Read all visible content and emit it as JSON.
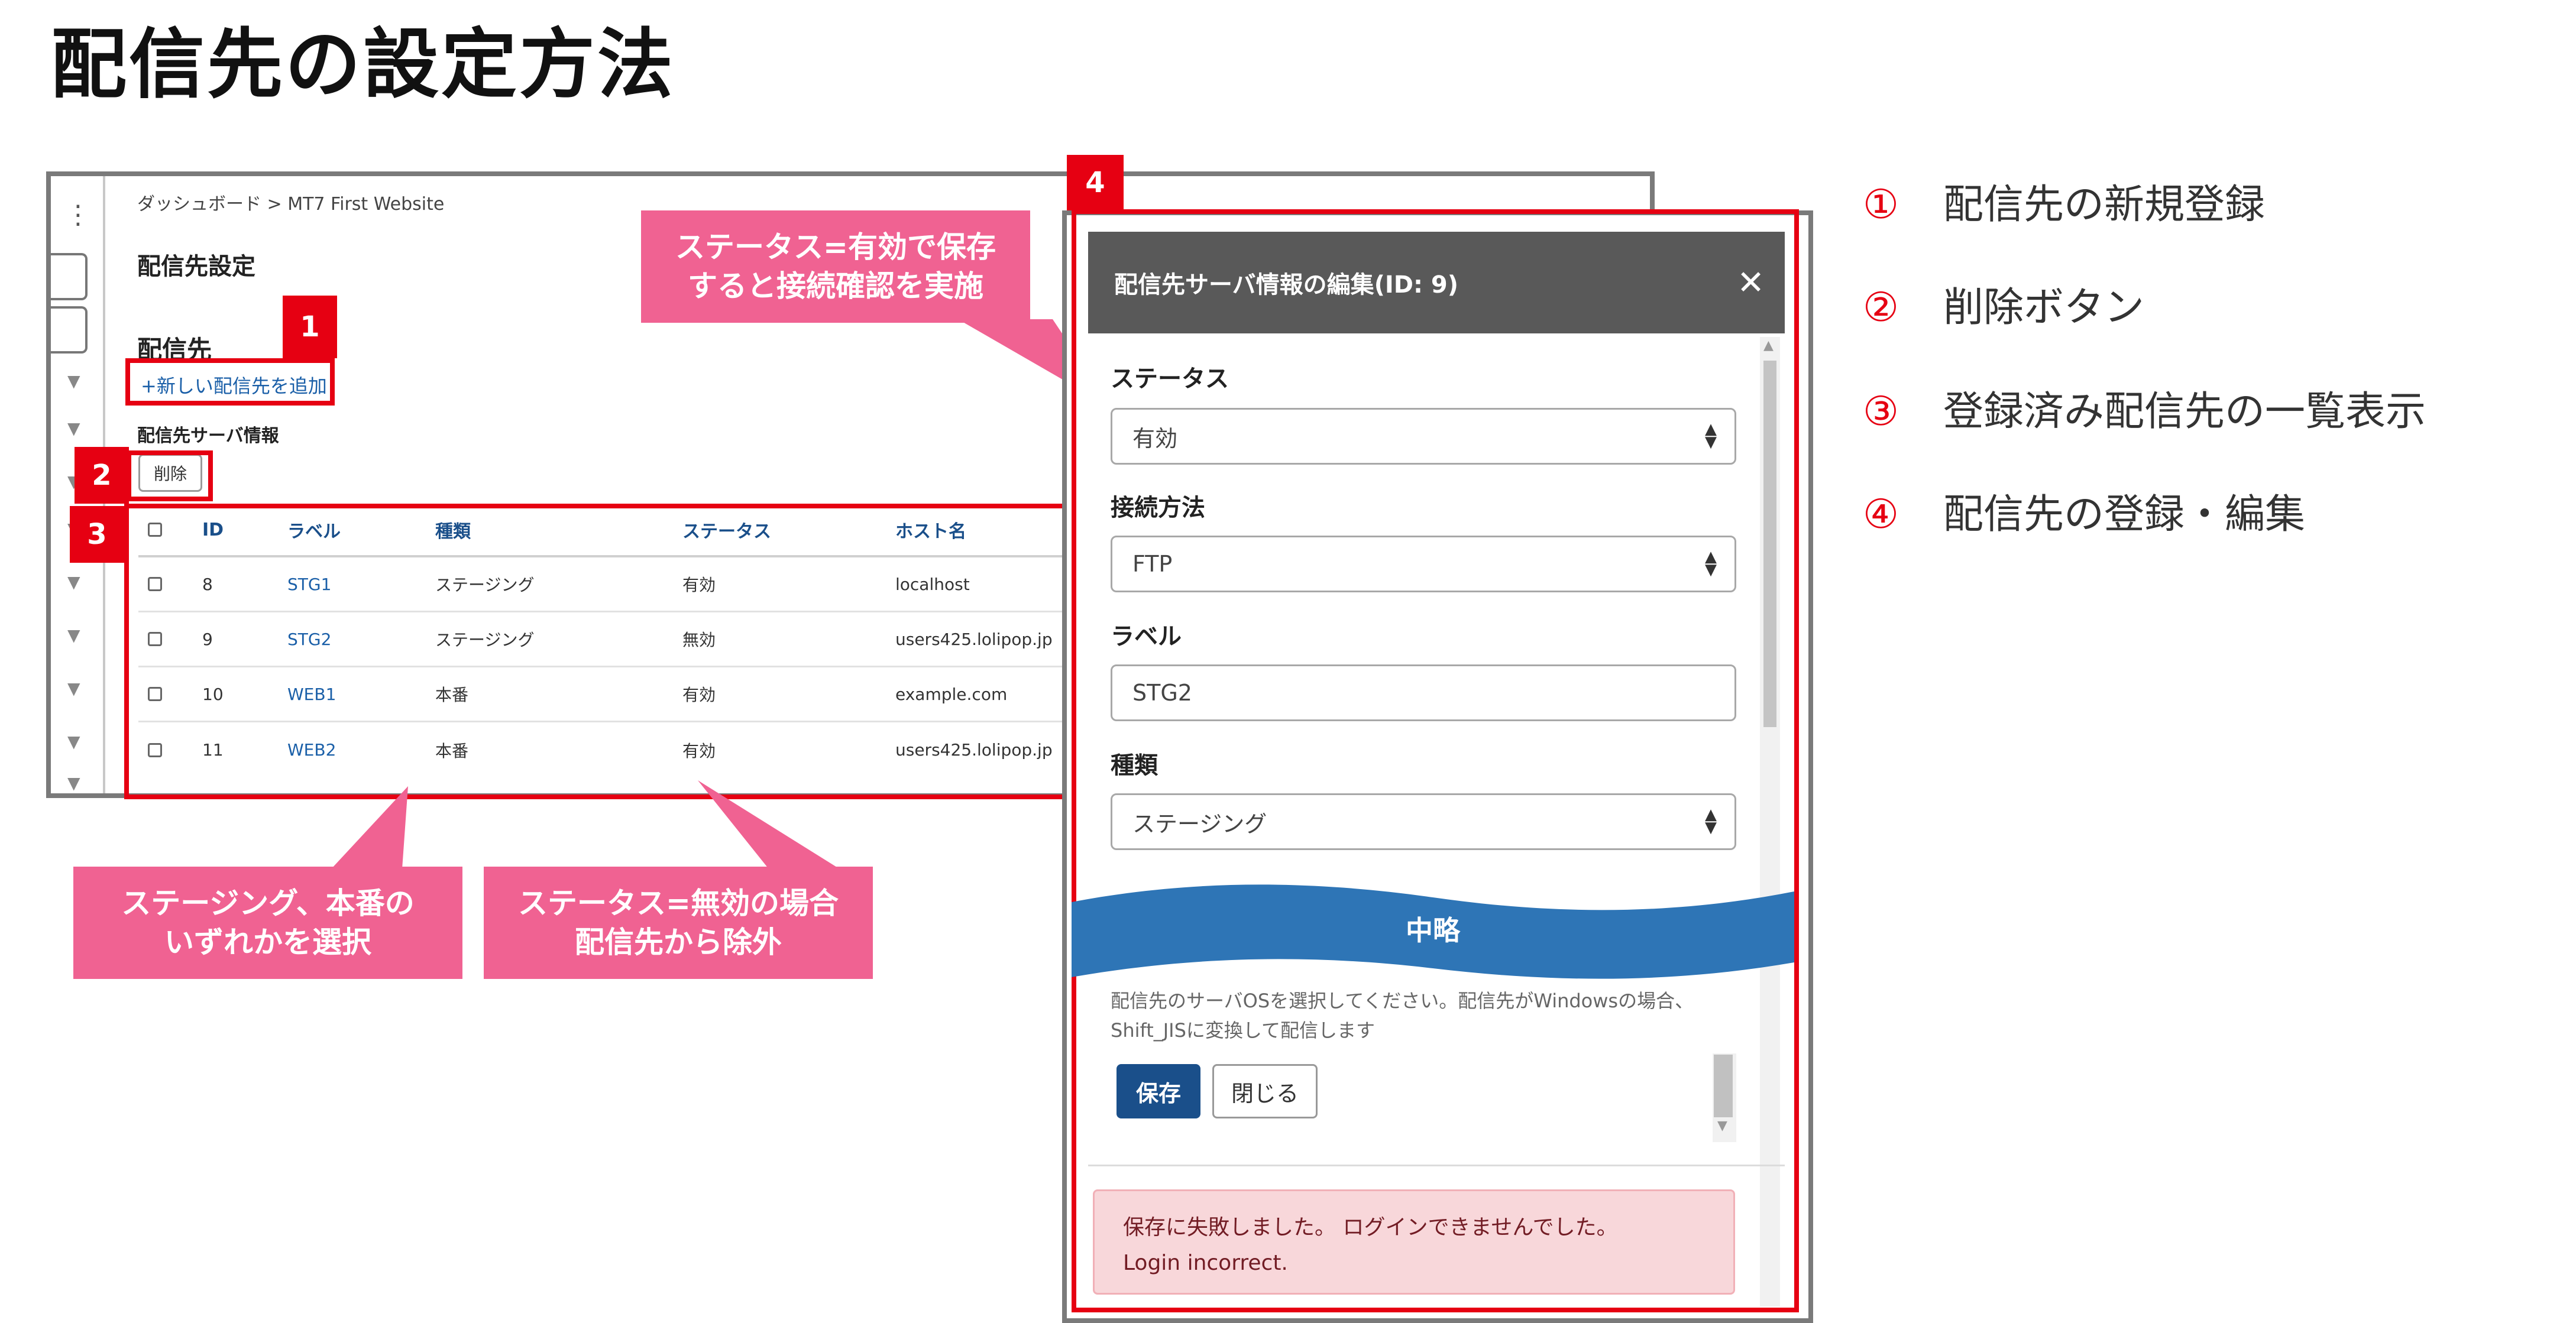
{
  "slide": {
    "title": "配信先の設定方法"
  },
  "cms": {
    "breadcrumb": "ダッシュボード  >  MT7 First Website",
    "page_heading": "配信先設定",
    "section_heading": "配信先",
    "add_link": "+新しい配信先を追加",
    "server_info_heading": "配信先サーバ情報",
    "delete_label": "削除",
    "table": {
      "headers": [
        "ID",
        "ラベル",
        "種類",
        "ステータス",
        "ホスト名"
      ],
      "rows": [
        {
          "id": "8",
          "label": "STG1",
          "type": "ステージング",
          "status": "有効",
          "host": "localhost"
        },
        {
          "id": "9",
          "label": "STG2",
          "type": "ステージング",
          "status": "無効",
          "host": "users425.lolipop.jp"
        },
        {
          "id": "10",
          "label": "WEB1",
          "type": "本番",
          "status": "有効",
          "host": "example.com"
        },
        {
          "id": "11",
          "label": "WEB2",
          "type": "本番",
          "status": "有効",
          "host": "users425.lolipop.jp"
        }
      ]
    }
  },
  "markers": [
    "1",
    "2",
    "3",
    "4"
  ],
  "callouts": {
    "status_save_line1": "ステータス=有効で保存",
    "status_save_line2": "すると接続確認を実施",
    "type_select_line1": "ステージング、本番の",
    "type_select_line2": "いずれかを選択",
    "status_disabled_line1": "ステータス=無効の場合",
    "status_disabled_line2": "配信先から除外"
  },
  "modal": {
    "title": "配信先サーバ情報の編集(ID: 9)",
    "close_glyph": "✕",
    "status_label": "ステータス",
    "status_value": "有効",
    "connection_label": "接続方法",
    "connection_value": "FTP",
    "label_label": "ラベル",
    "label_value": "STG2",
    "type_label": "種類",
    "type_value": "ステージング",
    "omitted_banner": "中略",
    "os_help": "配信先のサーバOSを選択してください。配信先がWindowsの場合、Shift_JISに変換して配信します",
    "save_label": "保存",
    "close_label": "閉じる",
    "error_line1": "保存に失敗しました。 ログインできませんでした。",
    "error_line2": "Login incorrect."
  },
  "legend": [
    {
      "num": "①",
      "text": "配信先の新規登録"
    },
    {
      "num": "②",
      "text": "削除ボタン"
    },
    {
      "num": "③",
      "text": "登録済み配信先の一覧表示"
    },
    {
      "num": "④",
      "text": "配信先の登録・編集"
    }
  ],
  "colors": {
    "marker_red": "#e60012",
    "callout_pink": "#f06292",
    "banner_blue": "#2e75b6",
    "modal_header": "#595959",
    "primary_button": "#1a4f8a"
  }
}
